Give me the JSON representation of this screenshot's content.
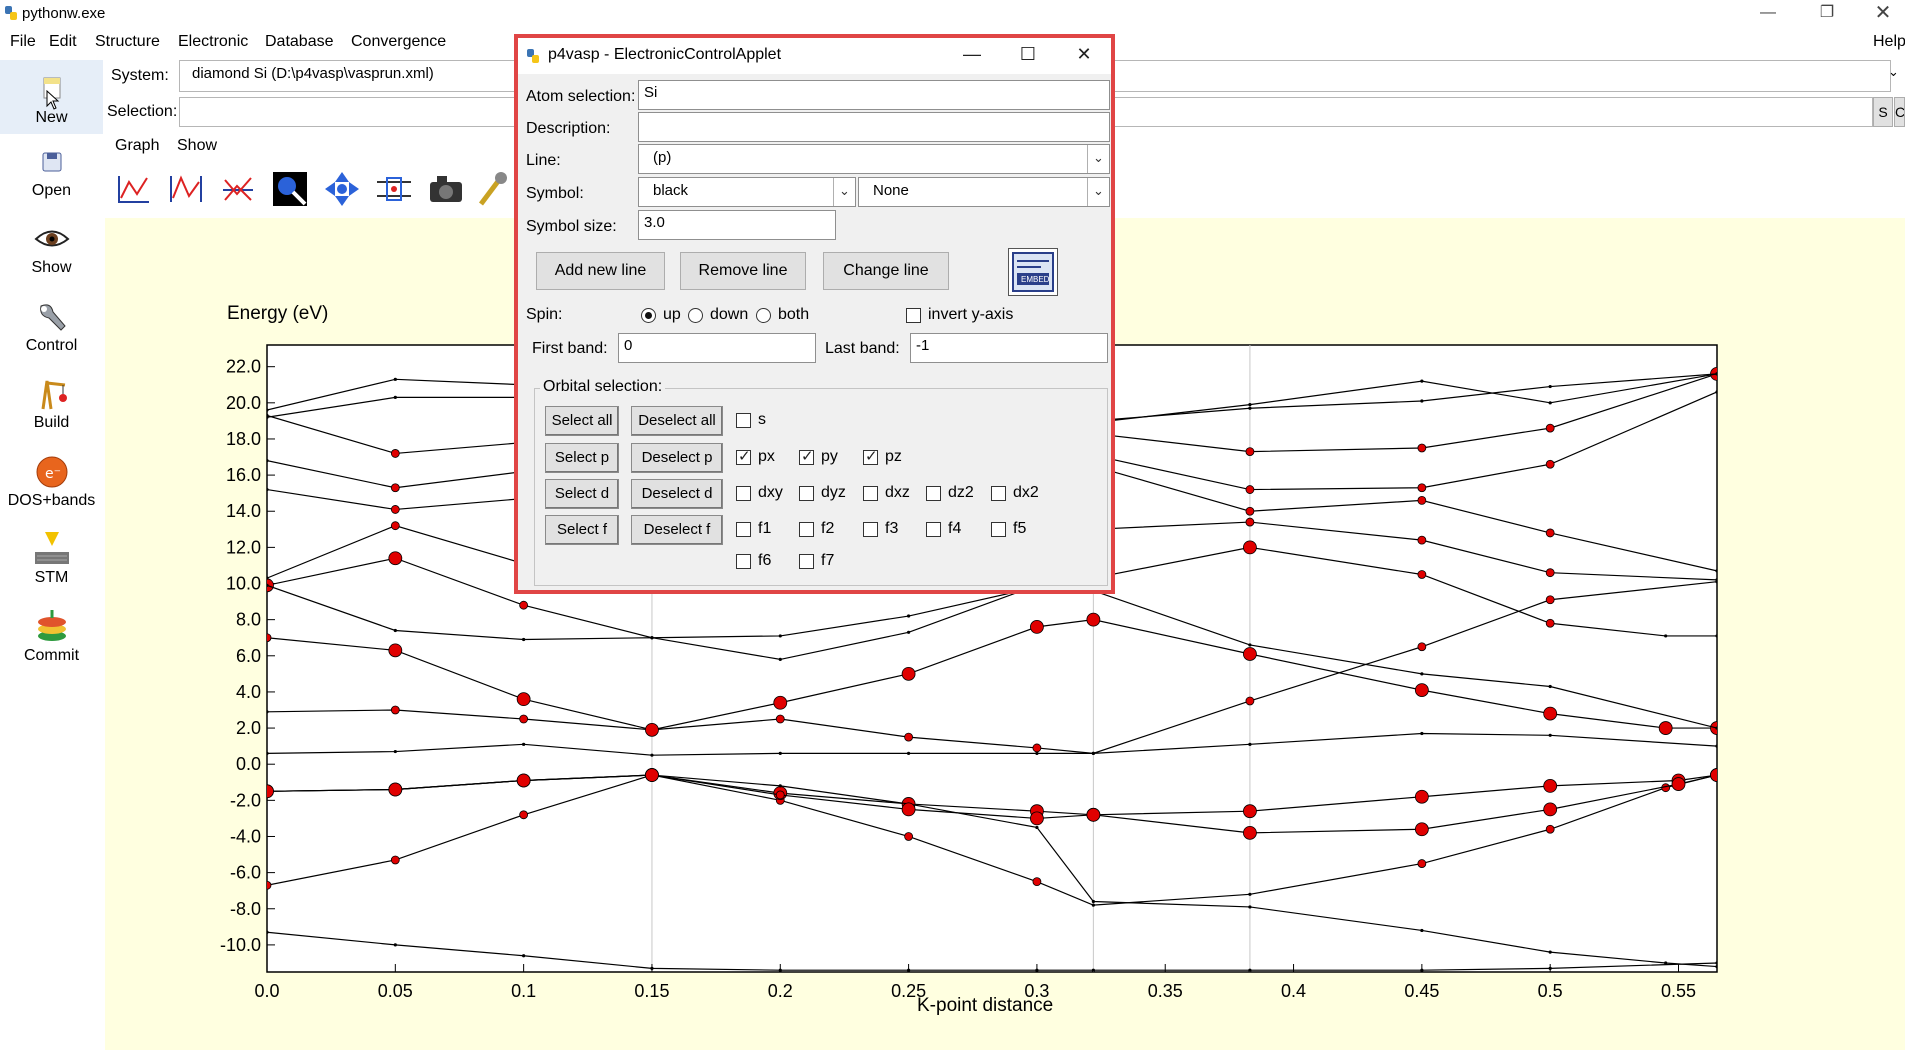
{
  "window": {
    "title": "pythonw.exe",
    "controls": [
      "—",
      "❐",
      "✕"
    ]
  },
  "menubar": {
    "items": [
      "File",
      "Edit",
      "Structure",
      "Electronic",
      "Database",
      "Convergence"
    ],
    "help": "Help"
  },
  "toolbar_left": [
    {
      "label": "New",
      "icon": "new-file-icon"
    },
    {
      "label": "Open",
      "icon": "open-icon"
    },
    {
      "label": "Show",
      "icon": "eye-icon"
    },
    {
      "label": "Control",
      "icon": "wrench-icon"
    },
    {
      "label": "Build",
      "icon": "crane-icon"
    },
    {
      "label": "DOS+bands",
      "icon": "electron-icon"
    },
    {
      "label": "STM",
      "icon": "stm-icon"
    },
    {
      "label": "Commit",
      "icon": "database-commit-icon"
    }
  ],
  "system": {
    "label": "System:",
    "value": "diamond Si (D:\\p4vasp\\vasprun.xml)"
  },
  "selection": {
    "label": "Selection:",
    "value": "",
    "btn_s": "S",
    "btn_c": "C"
  },
  "graph_menu": {
    "items": [
      "Graph",
      "Show"
    ]
  },
  "graph_toolbar": [
    "line-graph-icon",
    "peak-graph-icon",
    "band-graph-icon",
    "zoom-icon",
    "pan-icon",
    "select-icon",
    "camera-icon",
    "tool-icon"
  ],
  "dialog": {
    "title": "p4vasp - ElectronicControlApplet",
    "controls": [
      "—",
      "☐",
      "✕"
    ],
    "atom_selection": {
      "label": "Atom selection:",
      "value": "Si"
    },
    "description": {
      "label": "Description:",
      "value": ""
    },
    "line": {
      "label": "Line:",
      "value": "(p)"
    },
    "symbol": {
      "label": "Symbol:",
      "color": "black",
      "shape": "None"
    },
    "symbol_size": {
      "label": "Symbol size:",
      "value": "3.0"
    },
    "buttons": {
      "add": "Add new line",
      "remove": "Remove line",
      "change": "Change line"
    },
    "embed_icon": "EMBED",
    "spin": {
      "label": "Spin:",
      "options": [
        "up",
        "down",
        "both"
      ],
      "selected": "up"
    },
    "invert": {
      "label": "invert y-axis",
      "checked": false
    },
    "first_band": {
      "label": "First band:",
      "value": "0"
    },
    "last_band": {
      "label": "Last band:",
      "value": "-1"
    },
    "orbital": {
      "legend": "Orbital selection:",
      "rows": [
        {
          "select": "Select all",
          "deselect": "Deselect all",
          "items": [
            {
              "label": "s",
              "checked": false
            }
          ]
        },
        {
          "select": "Select p",
          "deselect": "Deselect p",
          "items": [
            {
              "label": "px",
              "checked": true
            },
            {
              "label": "py",
              "checked": true
            },
            {
              "label": "pz",
              "checked": true
            }
          ]
        },
        {
          "select": "Select d",
          "deselect": "Deselect d",
          "items": [
            {
              "label": "dxy",
              "checked": false
            },
            {
              "label": "dyz",
              "checked": false
            },
            {
              "label": "dxz",
              "checked": false
            },
            {
              "label": "dz2",
              "checked": false
            },
            {
              "label": "dx2",
              "checked": false
            }
          ]
        },
        {
          "select": "Select f",
          "deselect": "Deselect f",
          "items": [
            {
              "label": "f1",
              "checked": false
            },
            {
              "label": "f2",
              "checked": false
            },
            {
              "label": "f3",
              "checked": false
            },
            {
              "label": "f4",
              "checked": false
            },
            {
              "label": "f5",
              "checked": false
            }
          ]
        },
        {
          "select": "",
          "deselect": "",
          "items": [
            {
              "label": "f6",
              "checked": false
            },
            {
              "label": "f7",
              "checked": false
            }
          ]
        }
      ]
    }
  },
  "chart_data": {
    "type": "line",
    "title": "",
    "ylabel": "Energy (eV)",
    "xlabel": "K-point distance",
    "xlim": [
      0.0,
      0.565
    ],
    "ylim": [
      -11.5,
      23.2
    ],
    "xticks": [
      "0.0",
      "0.05",
      "0.1",
      "0.15",
      "0.2",
      "0.25",
      "0.3",
      "0.35",
      "0.4",
      "0.45",
      "0.5",
      "0.55"
    ],
    "yticks": [
      "22.0",
      "20.0",
      "18.0",
      "16.0",
      "14.0",
      "12.0",
      "10.0",
      "8.0",
      "6.0",
      "4.0",
      "2.0",
      "0.0",
      "-2.0",
      "-4.0",
      "-6.0",
      "-8.0",
      "-10.0"
    ],
    "vlines": [
      0.15,
      0.322,
      0.383
    ],
    "grid": false,
    "line_color": "#000000",
    "marker_color": "#e00000",
    "series": [
      {
        "x": [
          0.0,
          0.05,
          0.1,
          0.15,
          0.2,
          0.25,
          0.3,
          0.322,
          0.383,
          0.45,
          0.5,
          0.565
        ],
        "y": [
          -9.3,
          -10.0,
          -10.6,
          -11.3,
          -11.4,
          -11.4,
          -11.4,
          -11.4,
          -11.4,
          -11.4,
          -11.3,
          -11.0
        ],
        "m": [
          0,
          0,
          0,
          0,
          0,
          0,
          0,
          0,
          0,
          0,
          0,
          0
        ]
      },
      {
        "x": [
          0.0,
          0.05,
          0.1,
          0.15,
          0.2,
          0.25,
          0.3,
          0.322,
          0.383,
          0.45,
          0.5,
          0.545,
          0.565
        ],
        "y": [
          -6.7,
          -5.3,
          -2.8,
          -0.6,
          -2.0,
          -4.0,
          -6.5,
          -7.8,
          -7.2,
          -5.5,
          -3.6,
          -1.3,
          -0.6
        ],
        "m": [
          1,
          1,
          1,
          2,
          1,
          1,
          1,
          0,
          0,
          1,
          1,
          1,
          2
        ]
      },
      {
        "x": [
          0.0,
          0.05,
          0.1,
          0.15,
          0.2,
          0.25,
          0.3,
          0.322,
          0.383,
          0.45,
          0.5,
          0.55,
          0.565
        ],
        "y": [
          -1.5,
          -1.4,
          -0.9,
          -0.6,
          -1.6,
          -2.2,
          -2.6,
          -2.8,
          -2.6,
          -1.8,
          -1.2,
          -0.9,
          -0.6
        ],
        "m": [
          2,
          2,
          2,
          2,
          2,
          2,
          2,
          2,
          2,
          2,
          2,
          2,
          2
        ]
      },
      {
        "x": [
          0.0,
          0.05,
          0.1,
          0.15,
          0.2,
          0.25,
          0.3,
          0.322,
          0.383,
          0.45,
          0.5,
          0.545,
          0.565
        ],
        "y": [
          -1.5,
          -1.4,
          -0.9,
          -0.6,
          -1.2,
          -2.2,
          -3.5,
          -7.6,
          -7.9,
          -9.2,
          -10.4,
          -11.0,
          -11.2
        ],
        "m": [
          0,
          0,
          0,
          0,
          0,
          0,
          0,
          0,
          0,
          0,
          0,
          0,
          0
        ]
      },
      {
        "x": [
          0.0,
          0.05,
          0.1,
          0.15,
          0.2,
          0.25,
          0.3,
          0.322,
          0.383,
          0.45,
          0.5,
          0.55,
          0.565
        ],
        "y": [
          -1.5,
          -1.4,
          -0.9,
          -0.6,
          -1.7,
          -2.5,
          -3.0,
          -2.8,
          -3.8,
          -3.6,
          -2.5,
          -1.1,
          -0.6
        ],
        "m": [
          2,
          2,
          2,
          2,
          1,
          2,
          2,
          2,
          2,
          2,
          2,
          2,
          2
        ]
      },
      {
        "x": [
          0.0,
          0.05,
          0.1,
          0.15,
          0.2,
          0.25,
          0.3,
          0.322,
          0.383,
          0.45,
          0.5,
          0.565
        ],
        "y": [
          0.6,
          0.7,
          1.1,
          0.5,
          0.6,
          0.6,
          0.6,
          0.6,
          1.1,
          1.7,
          1.6,
          1.0
        ],
        "m": [
          0,
          0,
          0,
          0,
          0,
          0,
          0,
          0,
          0,
          0,
          0,
          0
        ]
      },
      {
        "x": [
          0.0,
          0.05,
          0.1,
          0.15,
          0.2,
          0.25,
          0.3,
          0.322,
          0.383,
          0.45,
          0.5,
          0.565
        ],
        "y": [
          2.9,
          3.0,
          2.5,
          1.9,
          2.5,
          1.5,
          0.9,
          0.6,
          3.5,
          6.5,
          9.1,
          10.1
        ],
        "m": [
          0,
          1,
          1,
          1,
          1,
          1,
          1,
          0,
          1,
          1,
          1,
          0
        ]
      },
      {
        "x": [
          0.0,
          0.05,
          0.1,
          0.15,
          0.2,
          0.25,
          0.3,
          0.322,
          0.383,
          0.45,
          0.5,
          0.545,
          0.565
        ],
        "y": [
          7.0,
          6.3,
          3.6,
          1.9,
          3.4,
          5.0,
          7.6,
          8.0,
          6.1,
          4.1,
          2.8,
          2.0,
          2.0
        ],
        "m": [
          1,
          2,
          2,
          2,
          2,
          2,
          2,
          2,
          2,
          2,
          2,
          2,
          2
        ]
      },
      {
        "x": [
          0.0,
          0.05,
          0.1,
          0.15,
          0.2,
          0.25,
          0.3,
          0.322,
          0.383,
          0.45,
          0.5,
          0.545,
          0.565
        ],
        "y": [
          9.9,
          11.4,
          8.8,
          7.0,
          7.1,
          8.2,
          9.8,
          10.3,
          12.0,
          10.5,
          7.8,
          7.1,
          7.1
        ],
        "m": [
          2,
          2,
          1,
          0,
          0,
          0,
          1,
          2,
          2,
          1,
          1,
          0,
          0
        ]
      },
      {
        "x": [
          0.0,
          0.05,
          0.1,
          0.15,
          0.2,
          0.25,
          0.3,
          0.322,
          0.383,
          0.45,
          0.5,
          0.565
        ],
        "y": [
          9.9,
          7.4,
          6.9,
          7.0,
          5.8,
          7.3,
          9.9,
          9.6,
          6.6,
          5.0,
          4.3,
          2.0
        ],
        "m": [
          0,
          0,
          0,
          0,
          0,
          0,
          0,
          0,
          0,
          0,
          0,
          0
        ]
      },
      {
        "x": [
          0.0,
          0.05,
          0.1,
          0.15,
          0.2,
          0.25,
          0.3,
          0.322,
          0.383,
          0.45,
          0.5,
          0.565
        ],
        "y": [
          10.3,
          13.2,
          11.1,
          10.0,
          9.8,
          11.7,
          12.8,
          13.0,
          13.4,
          12.4,
          10.6,
          10.2
        ],
        "m": [
          0,
          1,
          1,
          0,
          0,
          0,
          0,
          1,
          1,
          1,
          1,
          0
        ]
      },
      {
        "x": [
          0.0,
          0.05,
          0.1,
          0.15,
          0.2,
          0.25,
          0.3,
          0.322,
          0.383,
          0.45,
          0.5,
          0.565
        ],
        "y": [
          15.2,
          14.1,
          14.7,
          16.0,
          16.3,
          17.1,
          16.4,
          16.5,
          14.0,
          14.6,
          12.8,
          10.7
        ],
        "m": [
          0,
          1,
          1,
          0,
          0,
          0,
          0,
          1,
          1,
          1,
          1,
          0
        ]
      },
      {
        "x": [
          0.0,
          0.05,
          0.1,
          0.15,
          0.2,
          0.25,
          0.3,
          0.322,
          0.383,
          0.45,
          0.5,
          0.565
        ],
        "y": [
          16.8,
          15.3,
          16.2,
          16.9,
          17.2,
          17.9,
          17.2,
          17.1,
          15.2,
          15.3,
          16.6,
          20.6
        ],
        "m": [
          0,
          1,
          0,
          0,
          0,
          0,
          0,
          1,
          1,
          1,
          1,
          0
        ]
      },
      {
        "x": [
          0.0,
          0.05,
          0.1,
          0.15,
          0.2,
          0.25,
          0.3,
          0.322,
          0.383,
          0.45,
          0.5,
          0.565
        ],
        "y": [
          19.3,
          17.2,
          17.8,
          18.6,
          18.6,
          18.8,
          18.3,
          18.3,
          17.3,
          17.5,
          18.6,
          21.6
        ],
        "m": [
          0,
          1,
          1,
          0,
          0,
          0,
          0,
          1,
          1,
          1,
          1,
          2
        ]
      },
      {
        "x": [
          0.0,
          0.05,
          0.1,
          0.15,
          0.2,
          0.25,
          0.3,
          0.322,
          0.383,
          0.45,
          0.5,
          0.565
        ],
        "y": [
          19.6,
          21.3,
          21.0,
          20.6,
          20.1,
          19.9,
          19.0,
          18.9,
          19.9,
          21.2,
          20.0,
          21.6
        ],
        "m": [
          0,
          0,
          0,
          0,
          0,
          0,
          0,
          0,
          0,
          0,
          0,
          0
        ]
      },
      {
        "x": [
          0.0,
          0.05,
          0.1,
          0.15,
          0.2,
          0.25,
          0.3,
          0.322,
          0.383,
          0.45,
          0.5,
          0.565
        ],
        "y": [
          19.2,
          20.3,
          20.3,
          20.9,
          20.5,
          20.1,
          19.1,
          19.0,
          19.7,
          20.1,
          20.9,
          21.6
        ],
        "m": [
          0,
          0,
          0,
          0,
          0,
          0,
          0,
          0,
          0,
          0,
          0,
          0
        ]
      }
    ]
  }
}
